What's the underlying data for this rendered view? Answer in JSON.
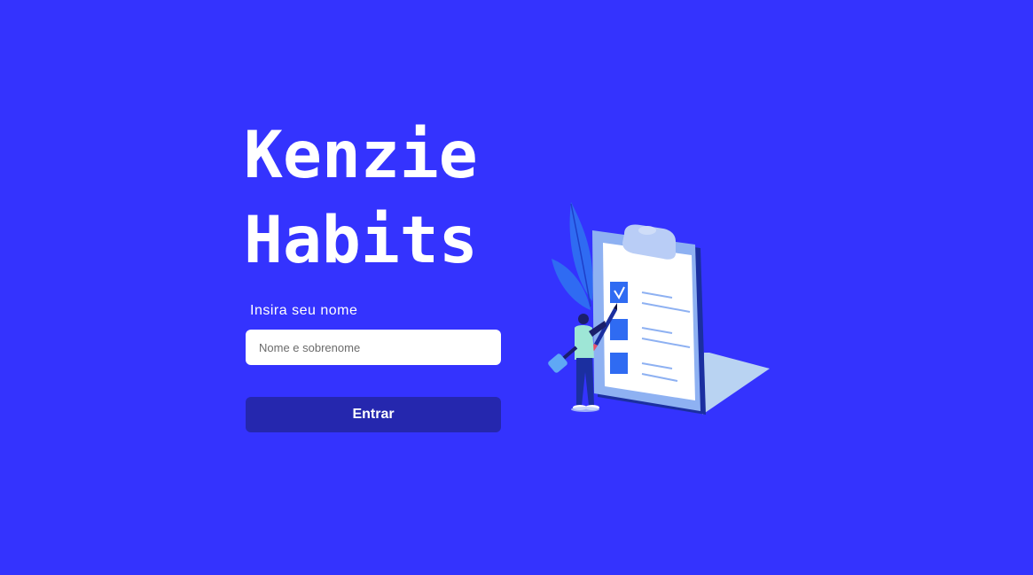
{
  "app": {
    "title_line1": "Kenzie",
    "title_line2": "Habits"
  },
  "form": {
    "name_label": "Insira seu nome",
    "name_placeholder": "Nome e sobrenome",
    "name_value": "",
    "submit_label": "Entrar"
  },
  "illustration": {
    "icon": "clipboard-checklist-illustration"
  },
  "colors": {
    "background": "#3433FE",
    "button": "#2527AE",
    "text": "#FFFFFF"
  }
}
